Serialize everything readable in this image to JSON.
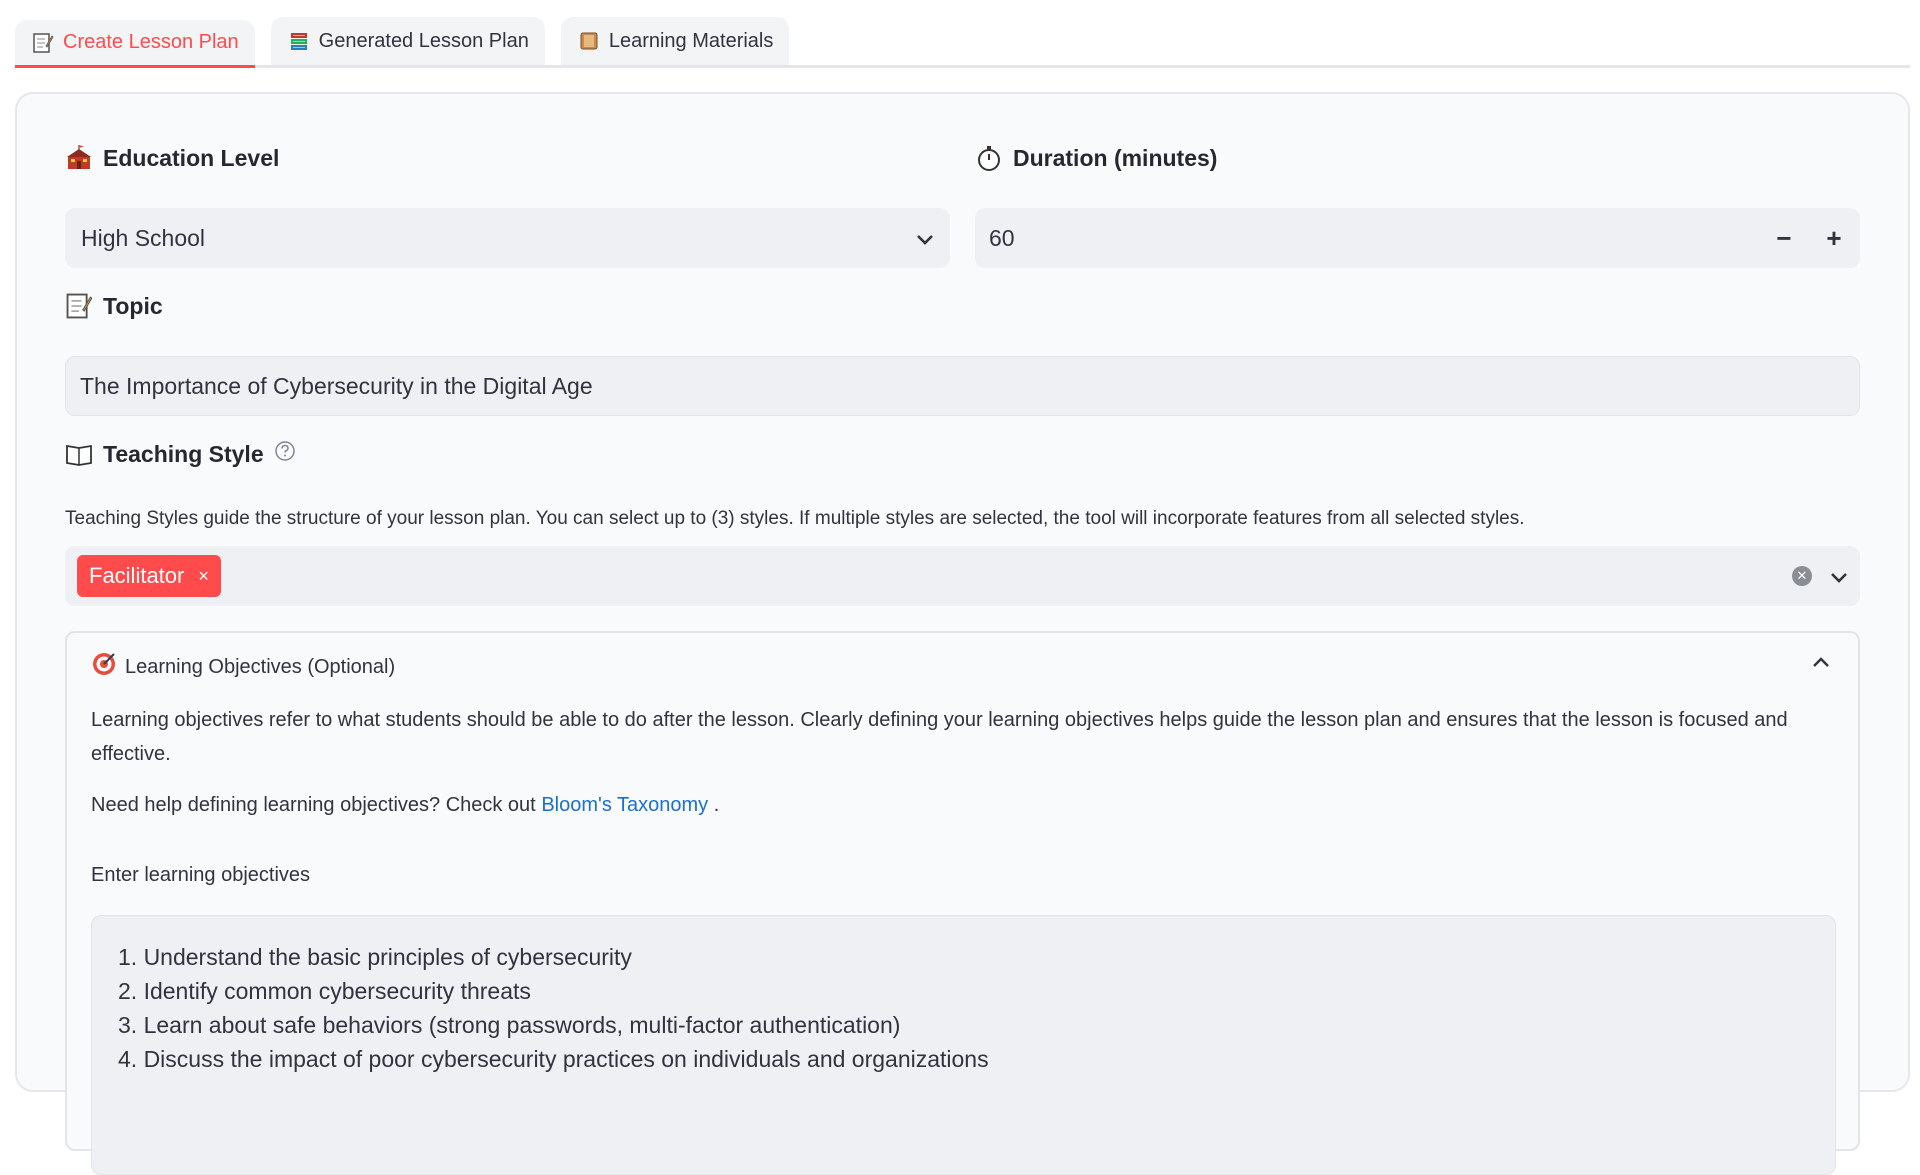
{
  "tabs": [
    {
      "label": "Create Lesson Plan",
      "icon": "memo-icon",
      "active": true
    },
    {
      "label": "Generated Lesson Plan",
      "icon": "books-icon",
      "active": false
    },
    {
      "label": "Learning Materials",
      "icon": "book-icon",
      "active": false
    }
  ],
  "form": {
    "education_level": {
      "label": "Education Level",
      "value": "High School"
    },
    "duration": {
      "label": "Duration (minutes)",
      "value": "60",
      "minus": "−",
      "plus": "+"
    },
    "topic": {
      "label": "Topic",
      "value": "The Importance of Cybersecurity in the Digital Age"
    },
    "teaching_style": {
      "label": "Teaching Style",
      "help": "Teaching Styles guide the structure of your lesson plan. You can select up to (3) styles. If multiple styles are selected, the tool will incorporate features from all selected styles.",
      "selected": [
        "Facilitator"
      ],
      "chip_remove": "×"
    }
  },
  "objectives": {
    "title": "Learning Objectives (Optional)",
    "description": "Learning objectives refer to what students should be able to do after the lesson. Clearly defining your learning objectives helps guide the lesson plan and ensures that the lesson is focused and effective.",
    "help_prefix": "Need help defining learning objectives? Check out",
    "help_link": "Bloom's Taxonomy",
    "help_suffix": ".",
    "input_label": "Enter learning objectives",
    "lines": [
      "1. Understand the basic principles of cybersecurity",
      "2. Identify common cybersecurity threats",
      "3. Learn about safe behaviors (strong passwords, multi-factor authentication)",
      "4. Discuss the impact of poor cybersecurity practices on individuals and organizations"
    ]
  },
  "colors": {
    "accent": "#ff4b4b",
    "link": "#1c6fd0"
  }
}
